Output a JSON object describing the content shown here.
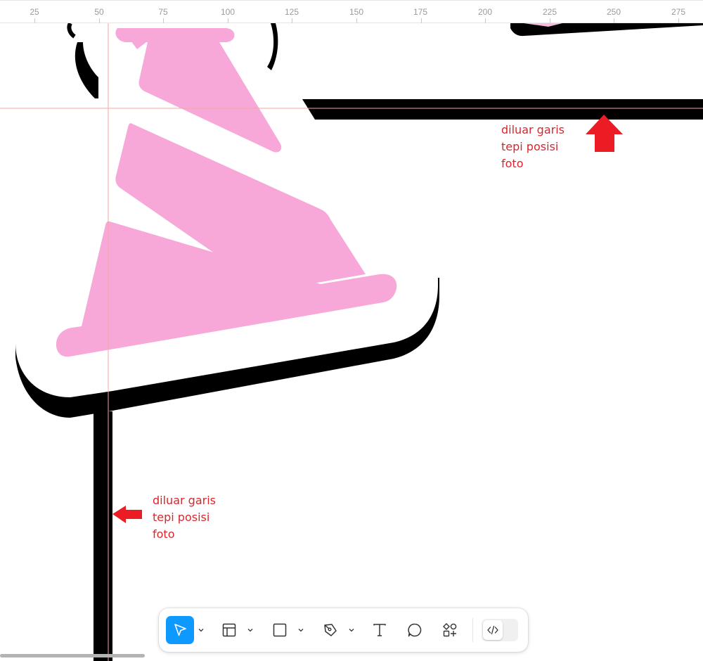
{
  "ruler": {
    "labels": [
      "25",
      "50",
      "75",
      "100",
      "125",
      "150",
      "175",
      "200",
      "225",
      "250",
      "275"
    ]
  },
  "annotations": {
    "right": "diluar garis\ntepi posisi\nfoto",
    "left": "diluar garis\ntepi posisi\nfoto"
  },
  "colors": {
    "annotation": "#d9262c",
    "arrow": "#ec1c24",
    "guide": "#f4a6a0",
    "pink": "#f7a8d8",
    "selection": "#0d99ff"
  },
  "toolbar": {
    "tools": [
      {
        "name": "move-tool",
        "icon": "cursor-icon",
        "active": true,
        "dropdown": true
      },
      {
        "name": "frame-tool",
        "icon": "frame-icon",
        "active": false,
        "dropdown": true
      },
      {
        "name": "shape-tool",
        "icon": "rectangle-icon",
        "active": false,
        "dropdown": true
      },
      {
        "name": "pen-tool",
        "icon": "pen-icon",
        "active": false,
        "dropdown": true
      },
      {
        "name": "text-tool",
        "icon": "text-icon",
        "active": false,
        "dropdown": false
      },
      {
        "name": "comment-tool",
        "icon": "comment-icon",
        "active": false,
        "dropdown": false
      },
      {
        "name": "resources-tool",
        "icon": "shapes-plus-icon",
        "active": false,
        "dropdown": false
      },
      {
        "name": "dev-mode-toggle",
        "icon": "code-icon",
        "active": false,
        "dropdown": false
      }
    ]
  }
}
